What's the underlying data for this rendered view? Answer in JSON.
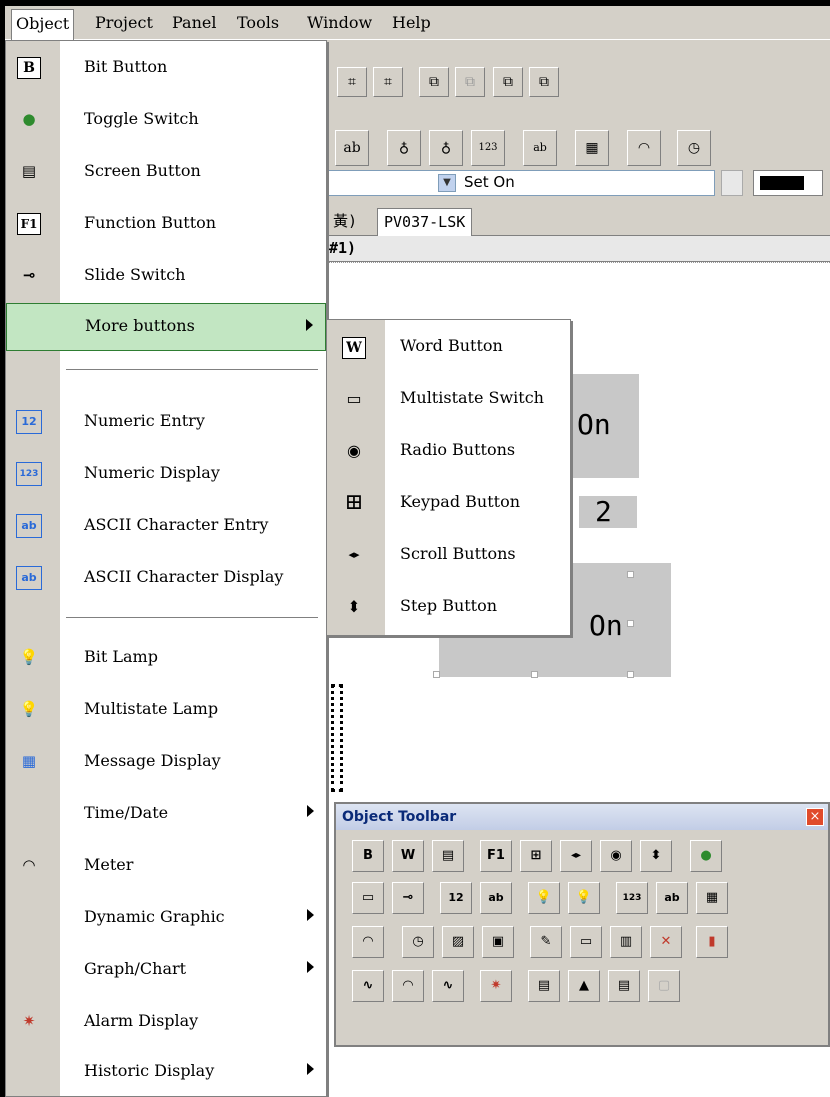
{
  "menubar": {
    "items": [
      "Object",
      "Project",
      "Panel",
      "Tools",
      "Window",
      "Help"
    ]
  },
  "background": {
    "combo_value": "Set On",
    "tabs": [
      "黃)",
      "PV037-LSK"
    ],
    "subtab": "#1)",
    "canvas_texts": [
      "On",
      "2",
      "On"
    ]
  },
  "object_menu": {
    "items": [
      {
        "label": "Bit Button",
        "icon": "bit-button-icon",
        "glyph": "B"
      },
      {
        "label": "Toggle Switch",
        "icon": "toggle-switch-icon",
        "glyph": "●"
      },
      {
        "label": "Screen Button",
        "icon": "screen-button-icon",
        "glyph": "▤"
      },
      {
        "label": "Function Button",
        "icon": "function-button-icon",
        "glyph": "F1"
      },
      {
        "label": "Slide Switch",
        "icon": "slide-switch-icon",
        "glyph": "⊸"
      },
      {
        "label": "More buttons",
        "icon": "",
        "glyph": "",
        "submenu": true
      },
      {
        "label": "Numeric Entry",
        "icon": "numeric-entry-icon",
        "glyph": "12"
      },
      {
        "label": "Numeric Display",
        "icon": "numeric-display-icon",
        "glyph": "123"
      },
      {
        "label": "ASCII Character Entry",
        "icon": "ascii-entry-icon",
        "glyph": "ab"
      },
      {
        "label": "ASCII Character Display",
        "icon": "ascii-display-icon",
        "glyph": "ab"
      },
      {
        "label": "Bit Lamp",
        "icon": "bit-lamp-icon",
        "glyph": "💡"
      },
      {
        "label": "Multistate Lamp",
        "icon": "multistate-lamp-icon",
        "glyph": "💡"
      },
      {
        "label": "Message Display",
        "icon": "message-display-icon",
        "glyph": "▦"
      },
      {
        "label": "Time/Date",
        "icon": "",
        "glyph": "",
        "submenu": true
      },
      {
        "label": "Meter",
        "icon": "meter-icon",
        "glyph": "◠"
      },
      {
        "label": "Dynamic Graphic",
        "icon": "",
        "glyph": "",
        "submenu": true
      },
      {
        "label": "Graph/Chart",
        "icon": "",
        "glyph": "",
        "submenu": true
      },
      {
        "label": "Alarm Display",
        "icon": "alarm-display-icon",
        "glyph": "✷"
      },
      {
        "label": "Historic Display",
        "icon": "",
        "glyph": "",
        "submenu": true
      }
    ]
  },
  "more_buttons_submenu": {
    "items": [
      {
        "label": "Word Button",
        "icon": "word-button-icon",
        "glyph": "W"
      },
      {
        "label": "Multistate Switch",
        "icon": "multistate-switch-icon",
        "glyph": "▭"
      },
      {
        "label": "Radio Buttons",
        "icon": "radio-buttons-icon",
        "glyph": "◉"
      },
      {
        "label": "Keypad Button",
        "icon": "keypad-button-icon",
        "glyph": "⊞"
      },
      {
        "label": "Scroll Buttons",
        "icon": "scroll-buttons-icon",
        "glyph": "◂▸"
      },
      {
        "label": "Step Button",
        "icon": "step-button-icon",
        "glyph": "⬍"
      }
    ]
  },
  "object_toolbar": {
    "title": "Object Toolbar",
    "close": "×",
    "rows": [
      [
        "B",
        "W",
        "▤",
        "F1",
        "⊞",
        "◂▸",
        "◉",
        "⬍",
        "●"
      ],
      [
        "▭",
        "⊸",
        "12",
        "ab",
        "💡",
        "💡",
        "123",
        "ab",
        "▦"
      ],
      [
        "◠",
        "◷",
        "▨",
        "▣",
        "✎",
        "▭",
        "▥",
        "✕",
        "▮"
      ],
      [
        "∿",
        "◠",
        "∿",
        "✷",
        "▤",
        "▲",
        "▤",
        "▢"
      ]
    ]
  }
}
